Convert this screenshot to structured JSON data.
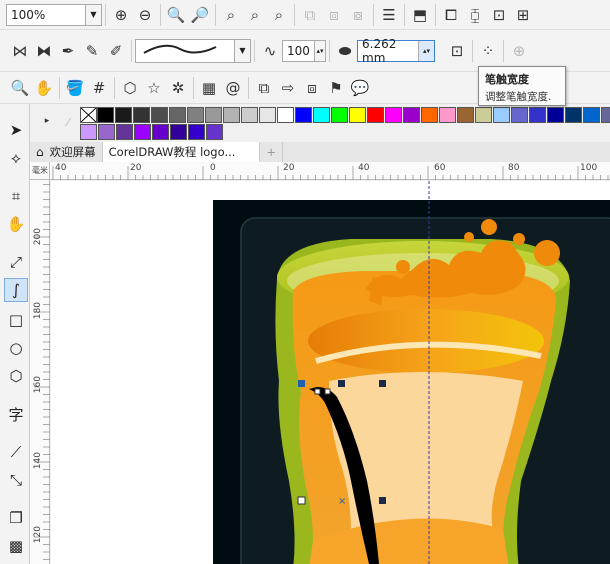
{
  "toolbar_top": {
    "zoom_value": "100%"
  },
  "property_bar": {
    "pen_width_value": "100",
    "nib_width_value": "6.262 mm"
  },
  "tooltip": {
    "title": "笔触宽度",
    "description": "调整笔触宽度."
  },
  "tabs": [
    {
      "label": "欢迎屏幕"
    },
    {
      "label": "CorelDRAW教程 logo..."
    },
    {
      "label": "+"
    }
  ],
  "ruler": {
    "horizontal_labels": [
      "40",
      "20",
      "0",
      "20",
      "40",
      "60",
      "80",
      "100"
    ],
    "vertical_labels": [
      "200",
      "180",
      "160",
      "140",
      "120"
    ],
    "unit": "毫米"
  },
  "palette": {
    "colors_row1": [
      "#000000",
      "#1a1a1a",
      "#333333",
      "#4d4d4d",
      "#666666",
      "#808080",
      "#999999",
      "#b3b3b3",
      "#cccccc",
      "#e6e6e6",
      "#ffffff",
      "#0000ff",
      "#00ffff",
      "#00ff00",
      "#ffff00",
      "#ff0000",
      "#ff00ff",
      "#9900cc",
      "#ff6600",
      "#ff99cc",
      "#996633",
      "#cccc99",
      "#99ccff",
      "#6666cc",
      "#3333cc",
      "#000099",
      "#003366",
      "#0066cc",
      "#666699"
    ],
    "colors_row2": [
      "#cc99ff",
      "#9966cc",
      "#663399",
      "#9900ff",
      "#6600cc",
      "#330099",
      "#3300cc",
      "#6633cc"
    ]
  },
  "colors": {
    "canvas_bg": "#ffffff",
    "artwork_bg": "#000d10",
    "glass_outline": "#9ab81e",
    "liquid_orange": "#f08a0a",
    "liquid_light": "#fcd79b",
    "selection_blue": "#1f5fb0"
  }
}
